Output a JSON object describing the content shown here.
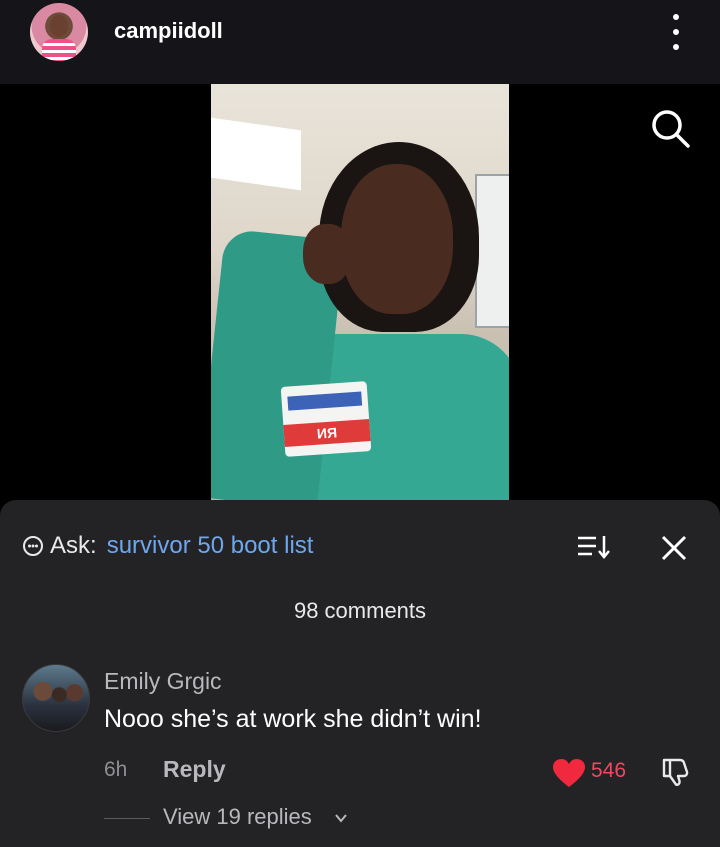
{
  "header": {
    "username": "campiidoll"
  },
  "video": {
    "badge_text": "ИЯ"
  },
  "comments_sheet": {
    "ask_label": "Ask:",
    "ask_query": "survivor 50 boot list",
    "comment_count": "98 comments",
    "comments": [
      {
        "author": "Emily Grgic",
        "text": "Nooo she’s at work she didn’t win!",
        "time": "6h",
        "reply_label": "Reply",
        "likes": "546",
        "view_replies": "View 19 replies"
      }
    ]
  },
  "colors": {
    "accent_link": "#6fa7ee",
    "like_red": "#f24661",
    "sheet_bg": "#232325",
    "header_bg": "#151519"
  },
  "icons": [
    "more-icon",
    "search-icon",
    "ask-icon",
    "sort-icon",
    "close-icon",
    "heart-icon",
    "dislike-icon",
    "chevron-down-icon"
  ]
}
